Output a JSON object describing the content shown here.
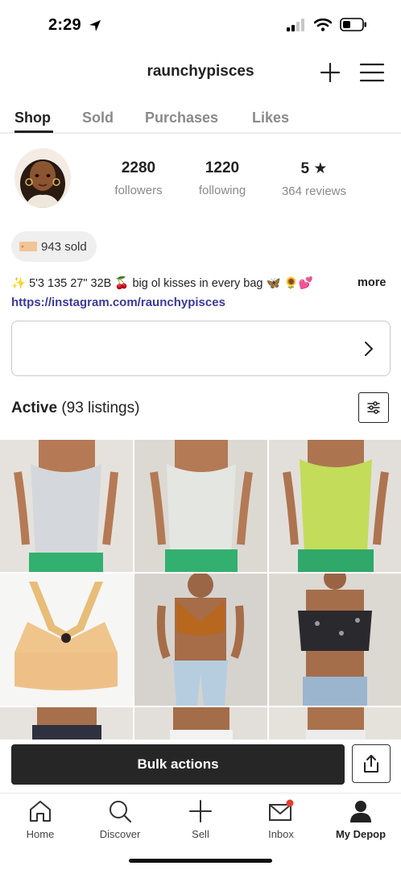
{
  "status_bar": {
    "time": "2:29"
  },
  "header": {
    "username": "raunchypisces"
  },
  "tabs": [
    {
      "label": "Shop",
      "active": true
    },
    {
      "label": "Sold",
      "active": false
    },
    {
      "label": "Purchases",
      "active": false
    },
    {
      "label": "Likes",
      "active": false
    }
  ],
  "profile": {
    "followers_count": "2280",
    "followers_label": "followers",
    "following_count": "1220",
    "following_label": "following",
    "rating": "5 ★",
    "reviews_label": "364 reviews",
    "sold_badge": "943 sold",
    "bio": "✨ 5'3 135 27\" 32B 🍒 big ol kisses in every bag 🦋 🌻💕",
    "bio_more": "more",
    "link": "https://instagram.com/raunchypisces"
  },
  "listings": {
    "title": "Active",
    "count_label": "(93 listings)"
  },
  "actions": {
    "bulk_label": "Bulk actions"
  },
  "bottom_nav": [
    {
      "label": "Home",
      "icon": "home-icon",
      "active": false
    },
    {
      "label": "Discover",
      "icon": "search-icon",
      "active": false
    },
    {
      "label": "Sell",
      "icon": "plus-icon",
      "active": false
    },
    {
      "label": "Inbox",
      "icon": "mail-icon",
      "active": false
    },
    {
      "label": "My Depop",
      "icon": "person-icon",
      "active": true
    }
  ],
  "colors": {
    "accent_link": "#3a3a9c",
    "notification_dot": "#e2412b",
    "bulk_button": "#262626"
  }
}
